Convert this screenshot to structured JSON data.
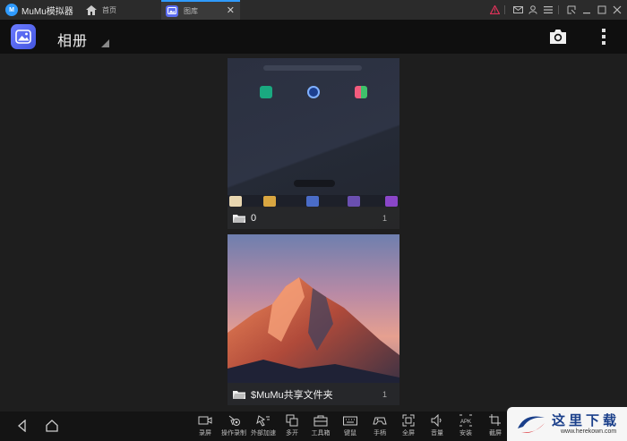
{
  "titlebar": {
    "app_title": "MuMu模拟器",
    "logo_text": "M",
    "tabs": [
      {
        "label": "首页",
        "icon": "home-icon"
      },
      {
        "label": "图库",
        "icon": "gallery-icon",
        "active": true
      }
    ],
    "close_glyph": "✕"
  },
  "header": {
    "title": "相册"
  },
  "albums": [
    {
      "name": "0",
      "count": "1"
    },
    {
      "name": "$MuMu共享文件夹",
      "count": "1"
    }
  ],
  "bottom_tools": [
    {
      "label": "录屏",
      "icon": "record-screen-icon"
    },
    {
      "label": "操作录制",
      "icon": "macro-record-icon"
    },
    {
      "label": "外部加速",
      "icon": "accelerate-icon"
    },
    {
      "label": "多开",
      "icon": "multi-instance-icon"
    },
    {
      "label": "工具箱",
      "icon": "toolbox-icon"
    },
    {
      "label": "键鼠",
      "icon": "keyboard-icon"
    },
    {
      "label": "手柄",
      "icon": "gamepad-icon"
    },
    {
      "label": "全屏",
      "icon": "fullscreen-icon"
    },
    {
      "label": "音量",
      "icon": "volume-icon"
    },
    {
      "label": "安装",
      "icon": "apk-install-icon"
    },
    {
      "label": "截屏",
      "icon": "screenshot-icon"
    }
  ],
  "watermark": {
    "text": "这里下载",
    "url": "www.herekown.com"
  },
  "colors": {
    "accent": "#2f9bff",
    "gallery_icon": "#5b6cf0",
    "alert": "#e0325a"
  }
}
